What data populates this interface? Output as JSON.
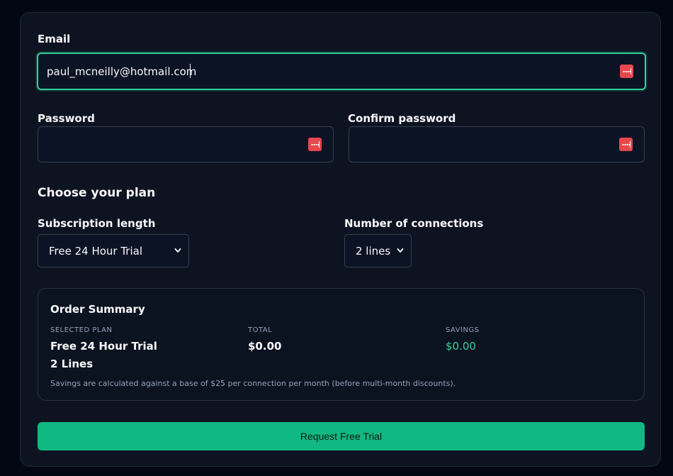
{
  "form": {
    "email_label": "Email",
    "email_value": "paul_mcneilly@hotmail.com",
    "password_label": "Password",
    "password_value": "",
    "confirm_label": "Confirm password",
    "confirm_value": ""
  },
  "plan": {
    "heading": "Choose your plan",
    "subscription_label": "Subscription length",
    "subscription_selected": "Free 24 Hour Trial",
    "connections_label": "Number of connections",
    "connections_selected": "2 lines"
  },
  "summary": {
    "title": "Order Summary",
    "selected_plan_caption": "SELECTED PLAN",
    "selected_plan_name": "Free 24 Hour Trial",
    "selected_plan_lines": "2 Lines",
    "total_caption": "TOTAL",
    "total_value": "$0.00",
    "savings_caption": "SAVINGS",
    "savings_value": "$0.00",
    "note": "Savings are calculated against a base of $25 per connection per month (before multi-month discounts)."
  },
  "actions": {
    "submit_label": "Request Free Trial"
  },
  "icons": {
    "password_manager": "password-manager-icon",
    "dropdown": "chevron-down-icon"
  },
  "colors": {
    "accent": "#10b981",
    "focus_border": "#34d399",
    "password_manager_icon": "#e5484d",
    "savings_text": "#34d399"
  }
}
